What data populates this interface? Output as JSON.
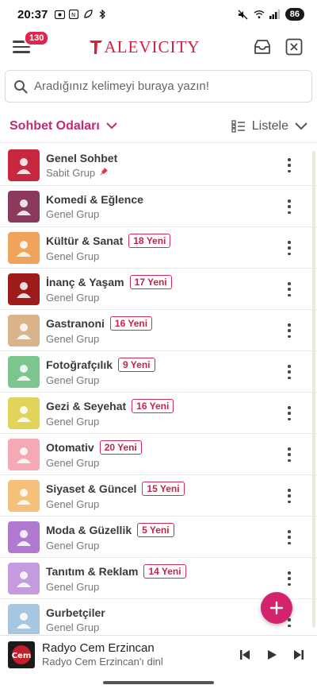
{
  "status_bar": {
    "time": "20:37",
    "battery": "86",
    "left_icons": [
      "screenshot-icon",
      "nfc-icon",
      "leaf-icon",
      "bluetooth-icon"
    ],
    "right_icons": [
      "mute-icon",
      "wifi-icon",
      "signal-icon"
    ]
  },
  "app_bar": {
    "menu_badge": "130",
    "logo_text": "ALEVICITY",
    "brand_color": "#d5213f"
  },
  "search": {
    "placeholder": "Aradığınız kelimeyi buraya yazın!"
  },
  "filter": {
    "rooms_label": "Sohbet Odaları",
    "view_label": "Listele",
    "accent_color": "#c22a76"
  },
  "rooms": [
    {
      "title": "Genel Sohbet",
      "subtitle": "Sabit Grup",
      "badge": "",
      "pinned": true,
      "icon": "alevi-logo-icon",
      "color": "#c8283f"
    },
    {
      "title": "Komedi & Eğlence",
      "subtitle": "Genel Grup",
      "badge": "",
      "pinned": false,
      "icon": "theater-masks-icon",
      "color": "#8b3a5e"
    },
    {
      "title": "Kültür & Sanat",
      "subtitle": "Genel Grup",
      "badge": "18 Yeni",
      "pinned": false,
      "icon": "guitar-icon",
      "color": "#f0a35a"
    },
    {
      "title": "İnanç & Yaşam",
      "subtitle": "Genel Grup",
      "badge": "17 Yeni",
      "pinned": false,
      "icon": "hand-icon",
      "color": "#9e1c1c"
    },
    {
      "title": "Gastranoni",
      "subtitle": "Genel Grup",
      "badge": "16 Yeni",
      "pinned": false,
      "icon": "chef-icon",
      "color": "#d9b48a"
    },
    {
      "title": "Fotoğrafçılık",
      "subtitle": "Genel Grup",
      "badge": "9 Yeni",
      "pinned": false,
      "icon": "camera-icon",
      "color": "#7cc58f"
    },
    {
      "title": "Gezi & Seyehat",
      "subtitle": "Genel Grup",
      "badge": "16 Yeni",
      "pinned": false,
      "icon": "traveler-icon",
      "color": "#e2d35a"
    },
    {
      "title": "Otomativ",
      "subtitle": "Genel Grup",
      "badge": "20 Yeni",
      "pinned": false,
      "icon": "car-icon",
      "color": "#f4a9b5"
    },
    {
      "title": "Siyaset & Güncel",
      "subtitle": "Genel Grup",
      "badge": "15 Yeni",
      "pinned": false,
      "icon": "speaker-podium-icon",
      "color": "#f5c07a"
    },
    {
      "title": "Moda & Güzellik",
      "subtitle": "Genel Grup",
      "badge": "5 Yeni",
      "pinned": false,
      "icon": "fashion-woman-icon",
      "color": "#b07ad0"
    },
    {
      "title": "Tanıtım & Reklam",
      "subtitle": "Genel Grup",
      "badge": "14 Yeni",
      "pinned": false,
      "icon": "ads-icon",
      "color": "#c59be0"
    },
    {
      "title": "Gurbetçiler",
      "subtitle": "Genel Grup",
      "badge": "",
      "pinned": false,
      "icon": "family-icon",
      "color": "#a7c7e0"
    }
  ],
  "player": {
    "title": "Radyo Cem Erzincan",
    "subtitle": "Radyo Cem Erzincan'ı dinl",
    "thumb_text": "Cem"
  }
}
